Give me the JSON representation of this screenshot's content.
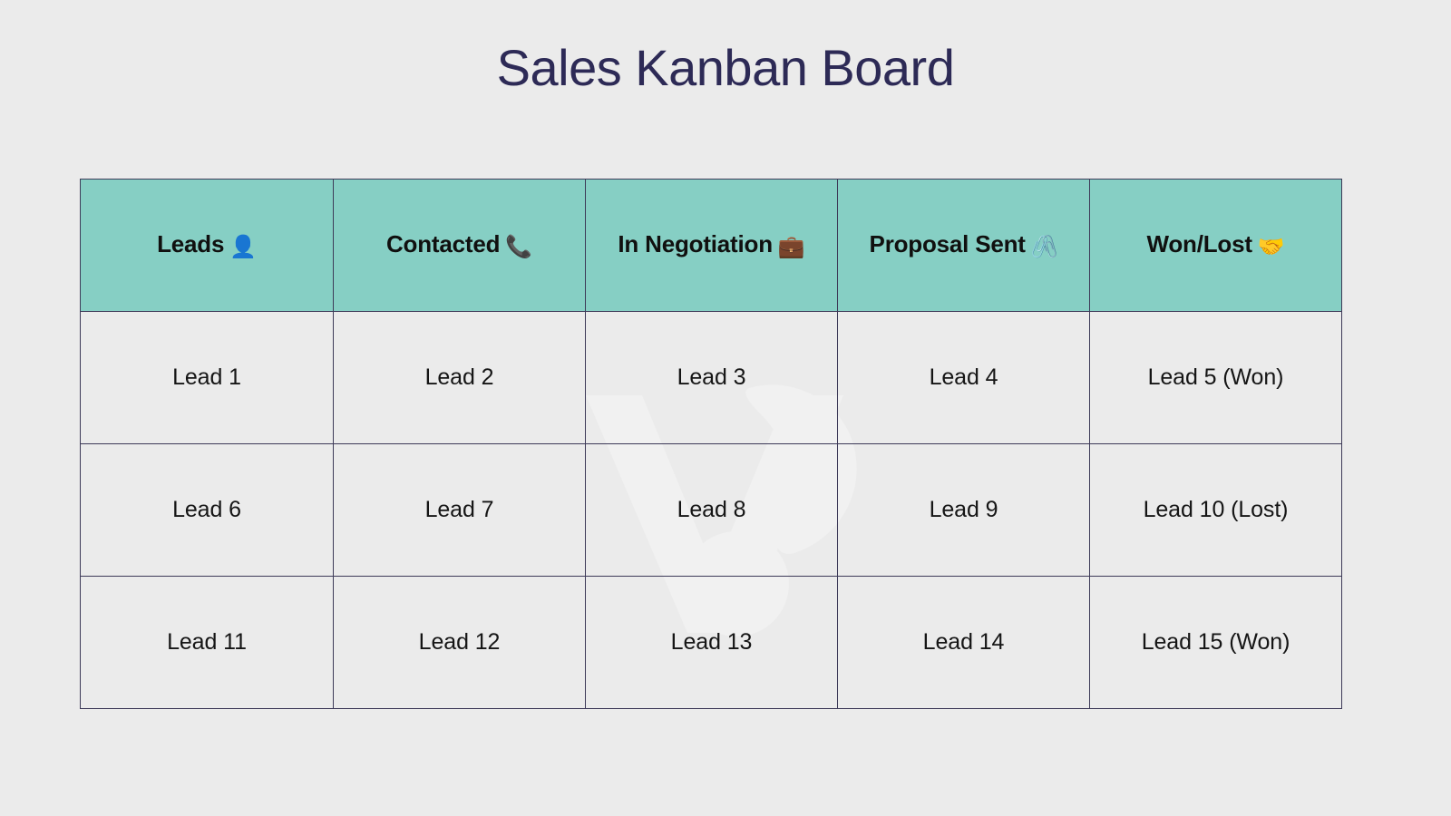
{
  "page": {
    "title": "Sales Kanban Board",
    "background_color": "#ebebeb",
    "title_color": "#2d2a56",
    "header_color": "#86cfc4",
    "border_color": "#3d3a58",
    "text_color": "#151515"
  },
  "board": {
    "columns": [
      {
        "label": "Leads",
        "emoji": "👤",
        "emoji_name": "bust-in-silhouette-icon"
      },
      {
        "label": "Contacted",
        "emoji": "📞",
        "emoji_name": "telephone-receiver-icon"
      },
      {
        "label": "In Negotiation",
        "emoji": "💼",
        "emoji_name": "briefcase-icon"
      },
      {
        "label": "Proposal Sent",
        "emoji": "🖇️",
        "emoji_name": "linked-paperclips-icon"
      },
      {
        "label": "Won/Lost",
        "emoji": "🤝",
        "emoji_name": "handshake-icon"
      }
    ],
    "rows": [
      [
        "Lead 1",
        "Lead 2",
        "Lead 3",
        "Lead 4",
        "Lead 5 (Won)"
      ],
      [
        "Lead 6",
        "Lead 7",
        "Lead 8",
        "Lead 9",
        "Lead 10 (Lost)"
      ],
      [
        "Lead 11",
        "Lead 12",
        "Lead 13",
        "Lead 14",
        "Lead 15 (Won)"
      ]
    ]
  }
}
